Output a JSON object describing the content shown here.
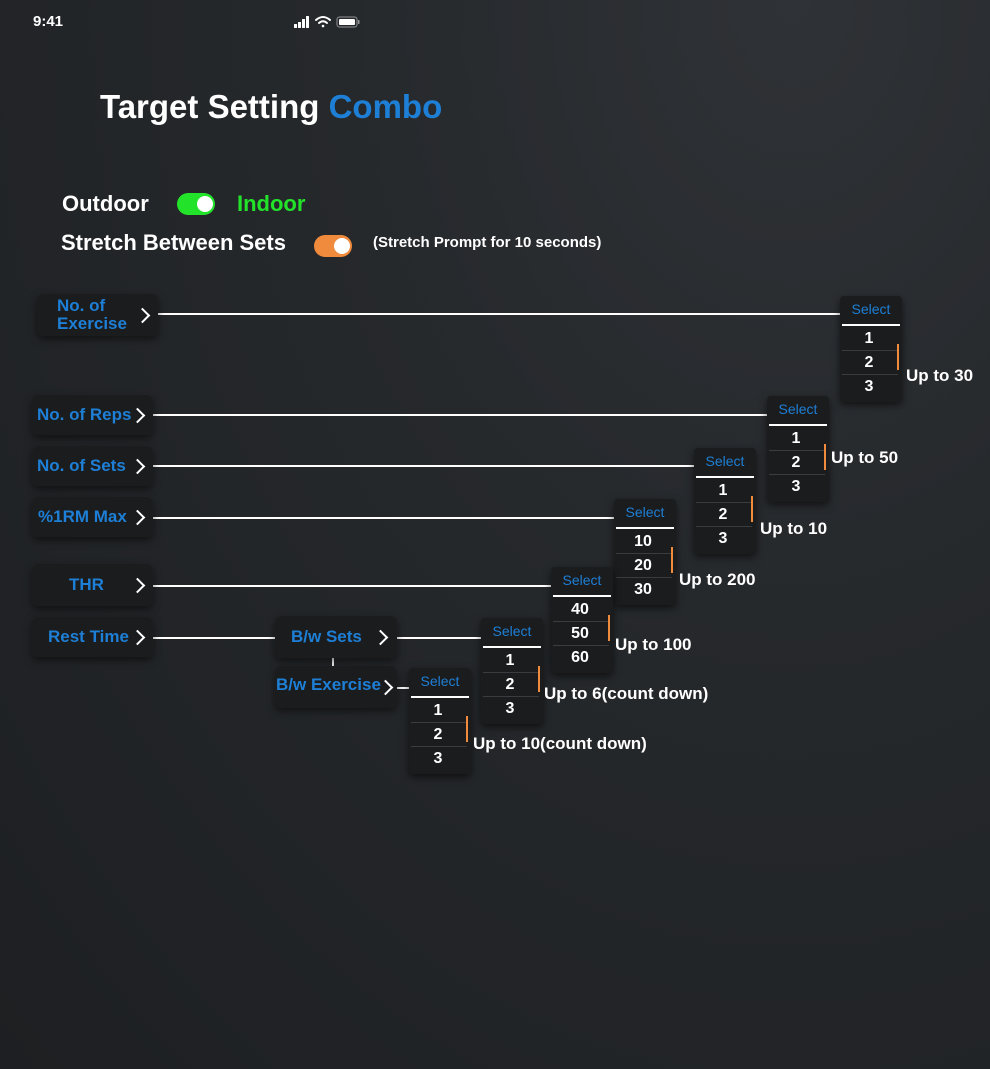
{
  "status_bar": {
    "time": "9:41"
  },
  "header": {
    "title_main": "Target Setting",
    "title_accent": "Combo"
  },
  "toggles": {
    "outdoor_label": "Outdoor",
    "indoor_label": "Indoor",
    "stretch_label": "Stretch Between Sets",
    "stretch_hint": "(Stretch Prompt for 10 seconds)",
    "indoor_color": "#22e32a",
    "stretch_color": "#f08a3c"
  },
  "buttons": {
    "no_of_exercise": "No. of Exercise",
    "no_of_reps": "No. of Reps",
    "no_of_sets": "No. of Sets",
    "rm_max": "%1RM Max",
    "thr": "THR",
    "rest_time": "Rest Time",
    "bw_sets": "B/w Sets",
    "bw_exercise": "B/w Exercise"
  },
  "pickers": {
    "exercise": {
      "placeholder": "Select",
      "options": [
        "1",
        "2",
        "3"
      ],
      "limit": "Up to 30"
    },
    "reps": {
      "placeholder": "Select",
      "options": [
        "1",
        "2",
        "3"
      ],
      "limit": "Up to 50"
    },
    "sets": {
      "placeholder": "Select",
      "options": [
        "1",
        "2",
        "3"
      ],
      "limit": "Up to 10"
    },
    "rm": {
      "placeholder": "Select",
      "options": [
        "10",
        "20",
        "30"
      ],
      "limit": "Up to 200"
    },
    "thr": {
      "placeholder": "Select",
      "options": [
        "40",
        "50",
        "60"
      ],
      "limit": "Up to 100"
    },
    "bw_sets": {
      "placeholder": "Select",
      "options": [
        "1",
        "2",
        "3"
      ],
      "limit": "Up to 6(count down)"
    },
    "bw_exercise": {
      "placeholder": "Select",
      "options": [
        "1",
        "2",
        "3"
      ],
      "limit": "Up to 10(count down)"
    }
  },
  "colors": {
    "accent": "#1e7fd6",
    "text": "#ffffff",
    "background": "#26292c"
  }
}
